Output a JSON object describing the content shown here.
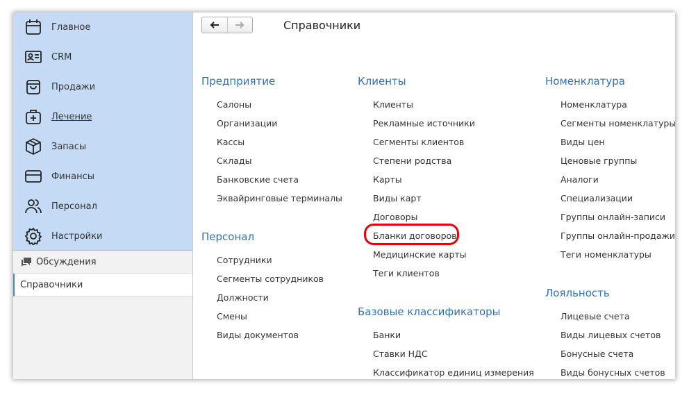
{
  "sidebar": {
    "items": [
      {
        "label": "Главное",
        "icon": "calendar-icon"
      },
      {
        "label": "CRM",
        "icon": "contact-card-icon"
      },
      {
        "label": "Продажи",
        "icon": "shopping-bag-icon"
      },
      {
        "label": "Лечение",
        "icon": "medical-case-icon",
        "active": true
      },
      {
        "label": "Запасы",
        "icon": "box-icon"
      },
      {
        "label": "Финансы",
        "icon": "credit-card-icon"
      },
      {
        "label": "Персонал",
        "icon": "people-icon"
      },
      {
        "label": "Настройки",
        "icon": "gear-icon"
      }
    ],
    "discussions_label": "Обсуждения",
    "current_label": "Справочники"
  },
  "header": {
    "title": "Справочники"
  },
  "sections": {
    "enterprise": {
      "title": "Предприятие",
      "links": [
        "Салоны",
        "Организации",
        "Кассы",
        "Склады",
        "Банковские счета",
        "Эквайринговые терминалы"
      ]
    },
    "staff": {
      "title": "Персонал",
      "links": [
        "Сотрудники",
        "Сегменты сотрудников",
        "Должности",
        "Смены",
        "Виды документов"
      ]
    },
    "clients": {
      "title": "Клиенты",
      "links": [
        "Клиенты",
        "Рекламные источники",
        "Сегменты клиентов",
        "Степени родства",
        "Карты",
        "Виды карт",
        "Договоры",
        "Бланки договоров",
        "Медицинские карты",
        "Теги клиентов"
      ]
    },
    "classifiers": {
      "title": "Базовые классификаторы",
      "links": [
        "Банки",
        "Ставки НДС",
        "Классификатор единиц измерения"
      ]
    },
    "nomenclature": {
      "title": "Номенклатура",
      "links": [
        "Номенклатура",
        "Сегменты номенклатуры",
        "Виды цен",
        "Ценовые группы",
        "Аналоги",
        "Специализации",
        "Группы онлайн-записи",
        "Группы онлайн-продажи",
        "Теги номенклатуры"
      ]
    },
    "loyalty": {
      "title": "Лояльность",
      "links": [
        "Лицевые счета",
        "Виды лицевых счетов",
        "Бонусные счета",
        "Виды бонусных счетов"
      ]
    }
  },
  "colors": {
    "accent": "#2e71c0",
    "sidebar": "#c5dbf5",
    "highlight": "#e8000d"
  }
}
